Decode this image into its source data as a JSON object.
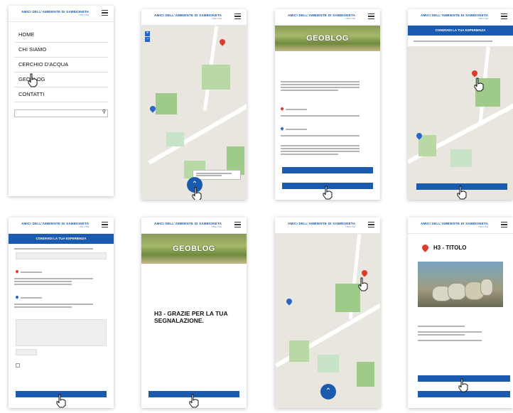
{
  "brand": {
    "logo_text": "AMICI DELL'AMBIENTE DI SABBIONETA",
    "logo_sub": "TREVISE"
  },
  "menu": {
    "items": [
      {
        "label": "HOME"
      },
      {
        "label": "CHI SIAMO"
      },
      {
        "label": "CERCHIO D'ACQUA"
      },
      {
        "label": "GEOBLOG"
      },
      {
        "label": "CONTATTI"
      }
    ]
  },
  "search": {
    "icon": "search-icon"
  },
  "geoblog": {
    "hero_title": "GEOBLOG"
  },
  "experience": {
    "bar_title": "CONDIVIDI LA TUA ESPERIENZA"
  },
  "thanks": {
    "heading": "H3 - GRAZIE PER LA TUA SEGNALAZIONE."
  },
  "detail": {
    "heading": "H3 - TITOLO"
  },
  "colors": {
    "brand_blue": "#1a5bb0",
    "pin_red": "#d93b2e",
    "pin_blue": "#2a66c8"
  }
}
